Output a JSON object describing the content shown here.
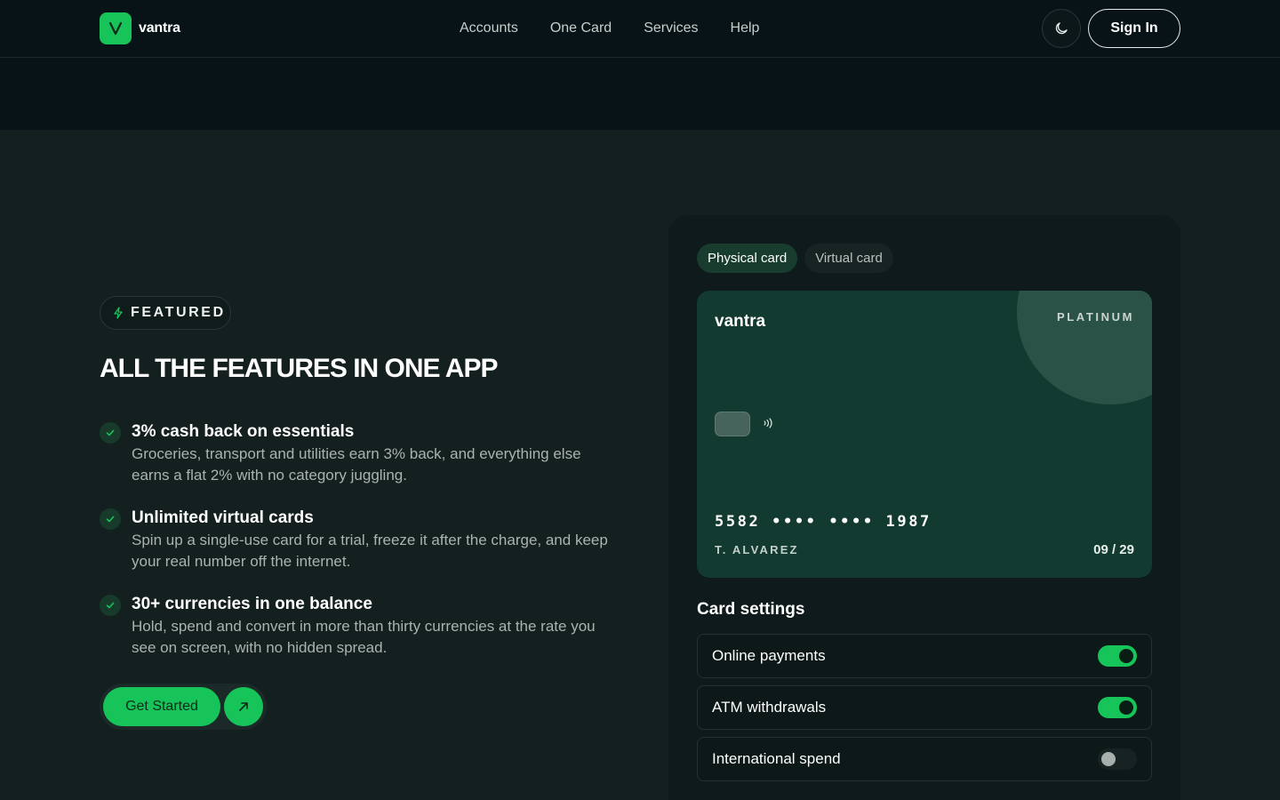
{
  "brand": {
    "name": "vantra",
    "logo_letter": "V",
    "accent": "#16c45a"
  },
  "nav": {
    "links": [
      "Accounts",
      "One Card",
      "Services",
      "Help"
    ],
    "theme_icon": "moon-icon",
    "sign_in": "Sign In"
  },
  "hero": {
    "badge": "FEATURED",
    "badge_icon": "lightning-icon",
    "title": "ALL THE FEATURES IN ONE APP",
    "features": [
      {
        "title": "3% cash back on essentials",
        "desc": "Groceries, transport and utilities earn 3% back, and everything else earns a flat 2% with no category juggling."
      },
      {
        "title": "Unlimited virtual cards",
        "desc": "Spin up a single-use card for a trial, freeze it after the charge, and keep your real number off the internet."
      },
      {
        "title": "30+ currencies in one balance",
        "desc": "Hold, spend and convert in more than thirty currencies at the rate you see on screen, with no hidden spread."
      }
    ],
    "cta": "Get Started",
    "cta_icon": "arrow-up-right-icon"
  },
  "card_panel": {
    "tabs": [
      {
        "label": "Physical card",
        "active": true
      },
      {
        "label": "Virtual card",
        "active": false
      }
    ],
    "card": {
      "brand": "vantra",
      "tier": "PLATINUM",
      "number": "5582 •••• •••• 1987",
      "holder": "T. ALVAREZ",
      "expiry": "09 / 29",
      "color": "#123a31"
    },
    "settings_title": "Card settings",
    "settings": [
      {
        "label": "Online payments",
        "enabled": true
      },
      {
        "label": "ATM withdrawals",
        "enabled": true
      },
      {
        "label": "International spend",
        "enabled": false
      }
    ]
  }
}
